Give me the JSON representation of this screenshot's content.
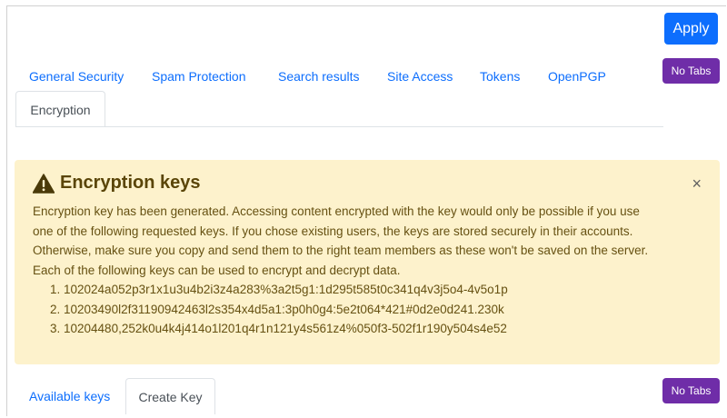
{
  "toolbar": {
    "apply_label": "Apply",
    "no_tabs_label": "No Tabs"
  },
  "tabs": [
    {
      "label": "General Security",
      "active": false
    },
    {
      "label": "Spam Protection",
      "active": false
    },
    {
      "label": "Search results",
      "active": false
    },
    {
      "label": "Site Access",
      "active": false
    },
    {
      "label": "Tokens",
      "active": false
    },
    {
      "label": "OpenPGP",
      "active": false
    },
    {
      "label": "Encryption",
      "active": true
    }
  ],
  "alert": {
    "icon": "warning-triangle-icon",
    "title": "Encryption keys",
    "close_glyph": "×",
    "lines": [
      "Encryption key has been generated. Accessing content encrypted with the key would only be possible if you use",
      "one of the following requested keys. If you chose existing users, the keys are stored securely in their accounts.",
      "Otherwise, make sure you copy and send them to the right team members as these won't be saved on the server.",
      "Each of the following keys can be used to encrypt and decrypt data."
    ],
    "keys": [
      "1. 102024a052p3r1x1u3u4b2i3z4a283%3a2t5g1:1d295t585t0c341q4v3j5o4-4v5o1p",
      "2. 10203490l2f31190942463l2s354x4d5a1:3p0h0g4:5e2t064*421#0d2e0d241.230k",
      "3. 10204480,252k0u4k4j414o1l201q4r1n121y4s561z4%050f3-502f1r190y504s4e52"
    ]
  },
  "bottom_tabs": [
    {
      "label": "Available keys",
      "active": false
    },
    {
      "label": "Create Key",
      "active": true
    }
  ],
  "bottom_toolbar": {
    "no_tabs_label": "No Tabs"
  },
  "colors": {
    "primary": "#0d6efd",
    "purple": "#6f2da8",
    "alert_bg": "#fdf2cc",
    "alert_text": "#665112"
  }
}
